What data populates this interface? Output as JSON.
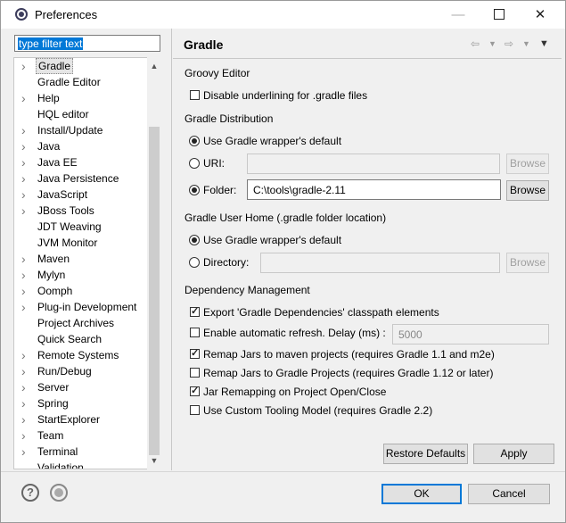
{
  "window": {
    "title": "Preferences",
    "controls": {
      "minimize": "—",
      "close": "✕"
    }
  },
  "filter": {
    "placeholder": "type filter text"
  },
  "tree": [
    {
      "label": "Gradle",
      "arrow": true
    },
    {
      "label": "Gradle Editor",
      "arrow": false
    },
    {
      "label": "Help",
      "arrow": true
    },
    {
      "label": "HQL editor",
      "arrow": false
    },
    {
      "label": "Install/Update",
      "arrow": true
    },
    {
      "label": "Java",
      "arrow": true
    },
    {
      "label": "Java EE",
      "arrow": true
    },
    {
      "label": "Java Persistence",
      "arrow": true
    },
    {
      "label": "JavaScript",
      "arrow": true
    },
    {
      "label": "JBoss Tools",
      "arrow": true
    },
    {
      "label": "JDT Weaving",
      "arrow": false
    },
    {
      "label": "JVM Monitor",
      "arrow": false
    },
    {
      "label": "Maven",
      "arrow": true
    },
    {
      "label": "Mylyn",
      "arrow": true
    },
    {
      "label": "Oomph",
      "arrow": true
    },
    {
      "label": "Plug-in Development",
      "arrow": true
    },
    {
      "label": "Project Archives",
      "arrow": false
    },
    {
      "label": "Quick Search",
      "arrow": false
    },
    {
      "label": "Remote Systems",
      "arrow": true
    },
    {
      "label": "Run/Debug",
      "arrow": true
    },
    {
      "label": "Server",
      "arrow": true
    },
    {
      "label": "Spring",
      "arrow": true
    },
    {
      "label": "StartExplorer",
      "arrow": true
    },
    {
      "label": "Team",
      "arrow": true
    },
    {
      "label": "Terminal",
      "arrow": true
    },
    {
      "label": "Validation",
      "arrow": false
    }
  ],
  "page": {
    "title": "Gradle",
    "groovy_editor": {
      "heading": "Groovy Editor",
      "disable_underlining": {
        "label": "Disable underlining for .gradle files",
        "checked": false
      }
    },
    "distribution": {
      "heading": "Gradle Distribution",
      "wrapper_default": "Use Gradle wrapper's default",
      "uri_label": "URI:",
      "uri_value": "",
      "folder_label": "Folder:",
      "folder_value": "C:\\tools\\gradle-2.11",
      "browse": "Browse",
      "selected": "folder"
    },
    "user_home": {
      "heading": "Gradle User Home (.gradle folder location)",
      "wrapper_default": "Use Gradle wrapper's default",
      "directory_label": "Directory:",
      "directory_value": "",
      "browse": "Browse",
      "selected": "wrapper"
    },
    "dependency": {
      "heading": "Dependency Management",
      "export_classpath": {
        "label": "Export 'Gradle Dependencies' classpath elements",
        "checked": true
      },
      "auto_refresh": {
        "label": "Enable automatic refresh. Delay (ms) :",
        "checked": false,
        "delay": "5000"
      },
      "remap_maven": {
        "label": "Remap Jars to maven projects (requires Gradle 1.1 and m2e)",
        "checked": true
      },
      "remap_gradle": {
        "label": "Remap Jars to Gradle Projects (requires Gradle 1.12 or later)",
        "checked": false
      },
      "remap_open_close": {
        "label": "Jar Remapping on Project Open/Close",
        "checked": true
      },
      "custom_tooling": {
        "label": "Use Custom Tooling Model (requires Gradle 2.2)",
        "checked": false
      }
    },
    "restore_defaults": "Restore Defaults",
    "apply": "Apply"
  },
  "footer": {
    "ok": "OK",
    "cancel": "Cancel",
    "help": "?"
  }
}
